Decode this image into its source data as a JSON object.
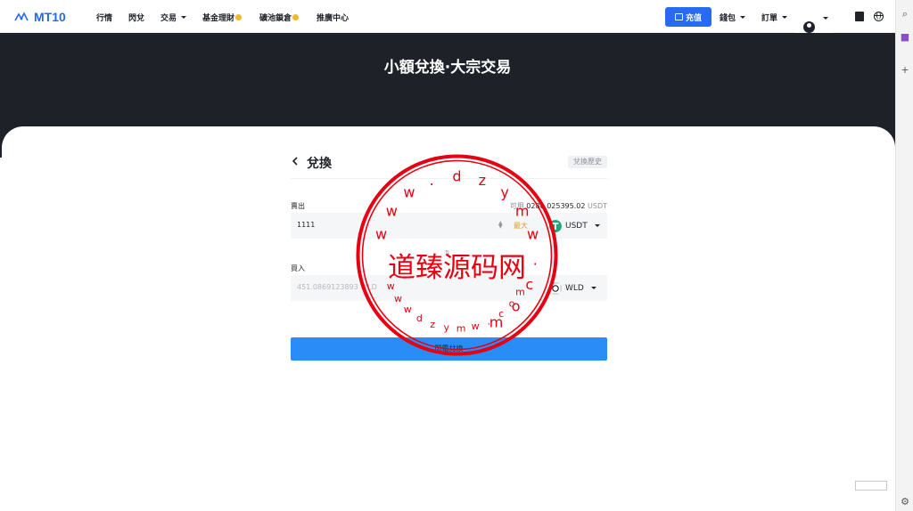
{
  "nav": {
    "brand": "MT10",
    "items": [
      {
        "label": "行情",
        "dropdown": false,
        "hand": false
      },
      {
        "label": "閃兌",
        "dropdown": false,
        "hand": false
      },
      {
        "label": "交易",
        "dropdown": true,
        "hand": false
      },
      {
        "label": "基金理財",
        "dropdown": false,
        "hand": true
      },
      {
        "label": "礦池鎖倉",
        "dropdown": false,
        "hand": true
      },
      {
        "label": "推廣中心",
        "dropdown": false,
        "hand": false
      }
    ],
    "deposit": "充值",
    "wallet": "錢包",
    "orders": "訂單"
  },
  "hero": {
    "title": "小額兌換·大宗交易"
  },
  "exchange": {
    "title": "兌換",
    "history": "兌換歷史",
    "sell_label": "賣出",
    "available_label": "可用",
    "available_value": "0280.025395.02",
    "available_unit": "USDT",
    "sell_value": "1111",
    "max": "最大",
    "sell_coin": "USDT",
    "buy_label": "買入",
    "buy_placeholder": "451.0869123893 WLD",
    "buy_coin": "WLD",
    "confirm": "閃電兌換"
  },
  "watermark": {
    "main": "道臻源码网",
    "ring_top": "dzym",
    "ring_letters": [
      "w",
      "w",
      "w",
      ".",
      "d",
      "z",
      "y",
      "m",
      "w",
      ".",
      "c",
      "o",
      "m"
    ],
    "ring_bottom": "wwwdzymw.com"
  },
  "colors": {
    "accent": "#2a6af3",
    "hero_bg": "#1e2228",
    "confirm_bg": "#2a8cf7",
    "usdt": "#26a17b",
    "stamp_red": "#e60012"
  }
}
